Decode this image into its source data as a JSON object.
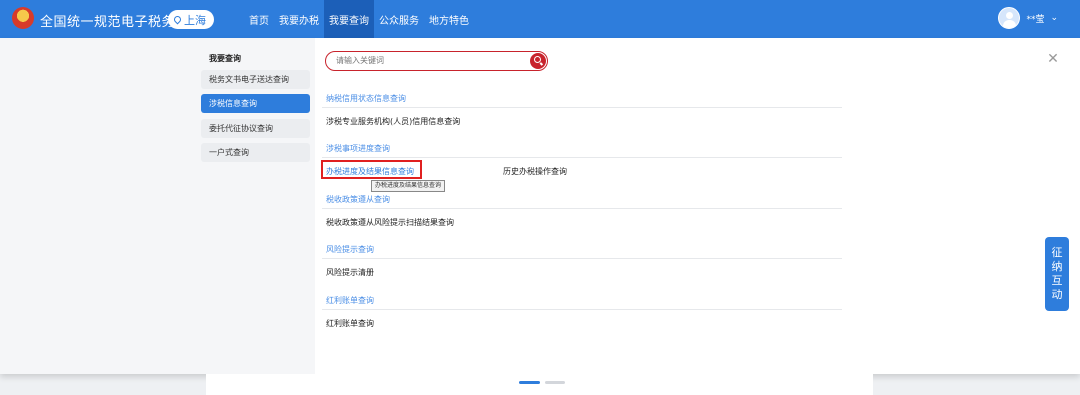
{
  "header": {
    "site_title": "全国统一规范电子税务局",
    "region": "上海",
    "nav": [
      "首页",
      "我要办税",
      "我要查询",
      "公众服务",
      "地方特色"
    ],
    "active_nav": "我要查询",
    "user_name": "**莹"
  },
  "sidebar": {
    "title": "我要查询",
    "items": [
      "税务文书电子送达查询",
      "涉税信息查询",
      "委托代征协议查询",
      "一户式查询"
    ],
    "active_item": "涉税信息查询"
  },
  "search": {
    "placeholder": "请输入关键词"
  },
  "sections": [
    {
      "title": "纳税信用状态信息查询",
      "links": [
        "涉税专业服务机构(人员)信用信息查询"
      ]
    },
    {
      "title": "涉税事项进度查询",
      "links": [
        "办税进度及结果信息查询",
        "历史办税操作查询"
      ]
    },
    {
      "title": "税收政策遵从查询",
      "links": [
        "税收政策遵从风险提示扫描结果查询"
      ]
    },
    {
      "title": "风险提示查询",
      "links": [
        "风险提示清册"
      ]
    },
    {
      "title": "红利账单查询",
      "links": [
        "红利账单查询"
      ]
    }
  ],
  "tooltip": "办税进度及结果信息查询",
  "float_button": [
    "征",
    "纳",
    "互",
    "动"
  ],
  "colors": {
    "primary": "#2e7ddc",
    "accent_red": "#c8232c",
    "section_blue": "#4a8ee6"
  },
  "icons": [
    "emblem-icon",
    "location-pin-icon",
    "user-avatar-icon",
    "chevron-down-icon",
    "search-icon",
    "close-icon"
  ]
}
